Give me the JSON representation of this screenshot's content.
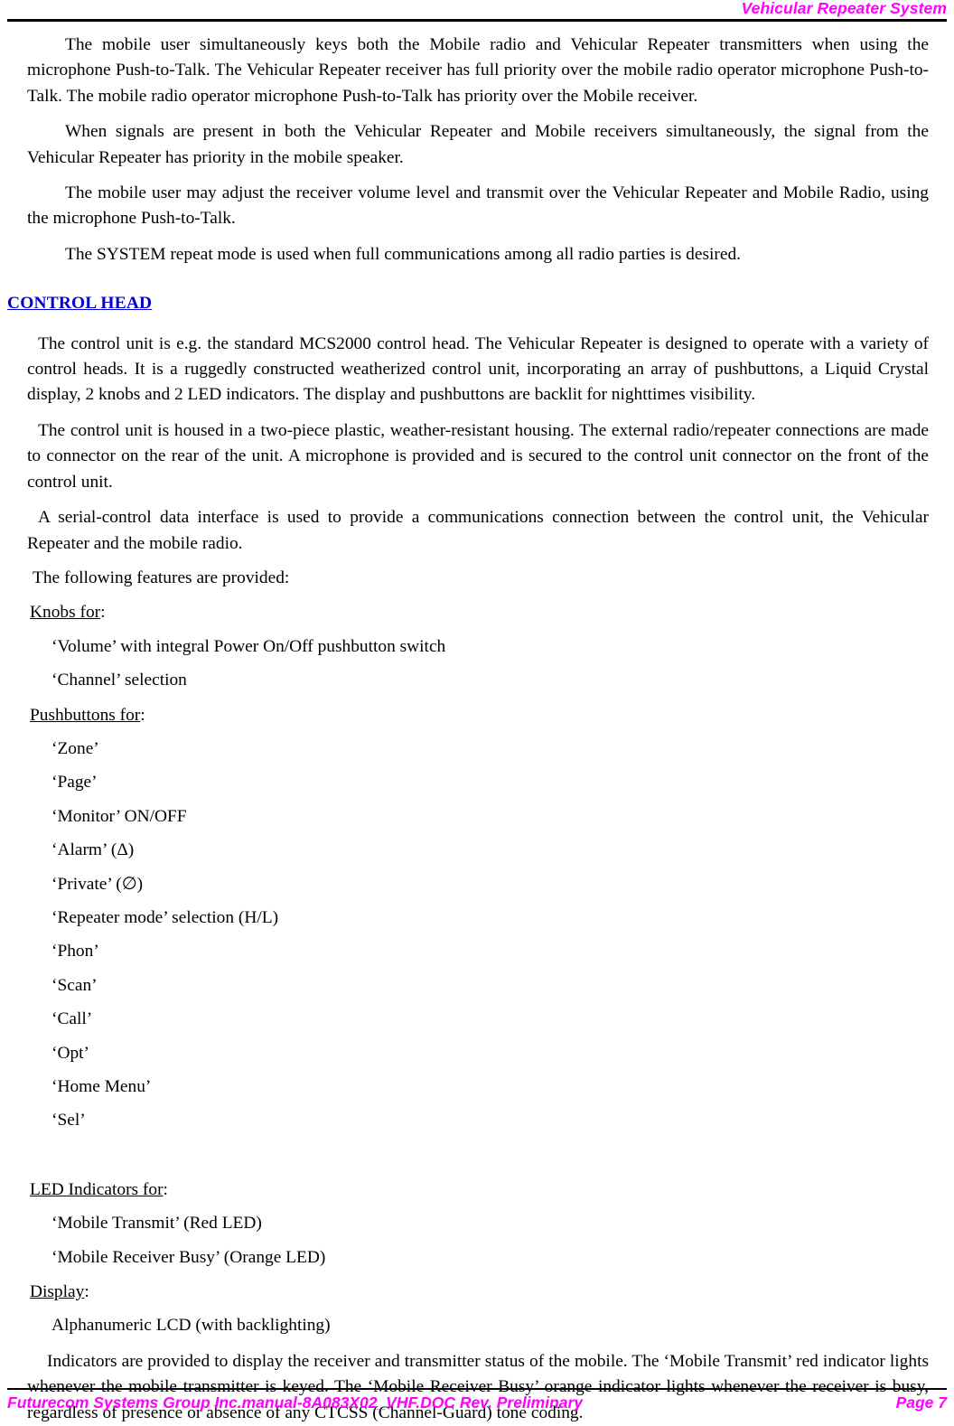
{
  "header": {
    "title": "Vehicular Repeater System",
    "title_color": "#FF00FF"
  },
  "body": {
    "paragraphs": [
      "The mobile user simultaneously keys both the Mobile radio and Vehicular Repeater transmitters when using the microphone Push-to-Talk. The Vehicular Repeater receiver has full priority over the mobile radio operator microphone Push-to-Talk. The mobile radio operator microphone Push-to-Talk has priority over the Mobile receiver.",
      "When signals are present in both the Vehicular Repeater and Mobile receivers simultaneously, the signal from the Vehicular Repeater has priority in the mobile speaker.",
      "The mobile user may adjust the receiver volume level and transmit over the Vehicular Repeater and Mobile Radio, using the microphone Push-to-Talk.",
      "The SYSTEM repeat mode is used when full communications among all radio parties is desired."
    ],
    "section_heading": "CONTROL HEAD",
    "section_heading_color": "#0000CC",
    "section_paragraphs": [
      "The control unit is e.g. the standard MCS2000 control head. The Vehicular Repeater is designed to operate with a variety of control heads. It is a ruggedly constructed weatherized control unit, incorporating an array of pushbuttons, a Liquid Crystal display, 2 knobs and 2 LED indicators. The display and pushbuttons are backlit for nighttimes visibility.",
      "The control unit is housed in a two-piece plastic, weather-resistant housing. The external radio/repeater connections are made to connector on the rear of the unit. A microphone is provided and is secured to the control unit connector on the front of the control unit.",
      "A serial-control data interface is used to provide a communications connection between the control unit, the Vehicular Repeater and the mobile radio."
    ],
    "features_lead": "The following features are provided:",
    "groups": [
      {
        "label_underlined": "Knobs for",
        "label_tail": ":",
        "items": [
          "‘Volume’ with integral Power On/Off pushbutton switch",
          "‘Channel’ selection"
        ]
      },
      {
        "label_underlined": "Pushbuttons for",
        "label_tail": ":",
        "items": [
          "‘Zone’",
          "‘Page’",
          "‘Monitor’ ON/OFF",
          "‘Alarm’ (Δ)",
          "‘Private’ (∅)",
          "‘Repeater mode’ selection (H/L)",
          "‘Phon’",
          "‘Scan’",
          "‘Call’",
          "‘Opt’",
          "‘Home Menu’",
          "‘Sel’"
        ]
      },
      {
        "label_underlined": "LED Indicators for",
        "label_tail": ":",
        "items": [
          "‘Mobile Transmit’ (Red LED)",
          "‘Mobile Receiver Busy’ (Orange LED)"
        ]
      },
      {
        "label_underlined": "Display",
        "label_tail": ":",
        "items": [
          "Alphanumeric LCD (with backlighting)"
        ]
      }
    ],
    "closing_paragraph": "Indicators are provided to display the receiver and transmitter status of the mobile. The ‘Mobile Transmit’ red indicator lights whenever the mobile transmitter is keyed. The ‘Mobile Receiver Busy’ orange indicator lights whenever the receiver is busy, regardless of presence or absence of any CTCSS (Channel-Guard) tone coding."
  },
  "footer": {
    "left_text": "Futurecom Systems Group Inc.manual-8A083X02_VHF.DOC Rev. Preliminary",
    "right_text": "Page 7",
    "text_color": "#FF00FF"
  }
}
